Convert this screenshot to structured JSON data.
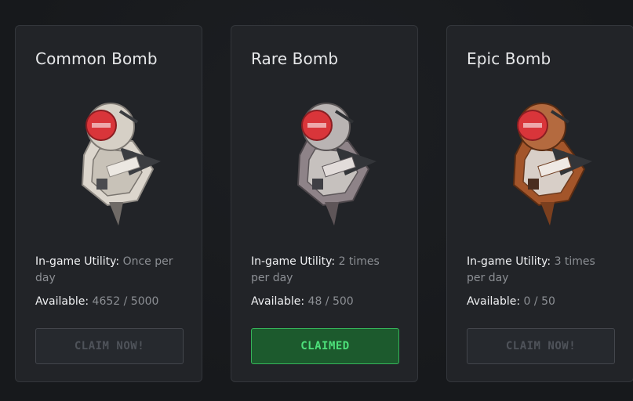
{
  "colors": {
    "page_background": "#17191c",
    "card_background": "#222428",
    "claimed_green": "#4de07a",
    "common_tint": "#d9d4cc",
    "rare_tint": "#9a8f93",
    "epic_tint": "#a55a2e"
  },
  "cards": [
    {
      "title": "Common Bomb",
      "utility_label": "In-game Utility:",
      "utility_value": "Once per day",
      "available_label": "Available:",
      "available_value": "4652 / 5000",
      "button_label": "CLAIM NOW!",
      "button_state": "disabled",
      "icon": "common-bomb-icon"
    },
    {
      "title": "Rare Bomb",
      "utility_label": "In-game Utility:",
      "utility_value": "2 times per day",
      "available_label": "Available:",
      "available_value": "48 / 500",
      "button_label": "CLAIMED",
      "button_state": "claimed",
      "icon": "rare-bomb-icon"
    },
    {
      "title": "Epic Bomb",
      "utility_label": "In-game Utility:",
      "utility_value": "3 times per day",
      "available_label": "Available:",
      "available_value": "0 / 50",
      "button_label": "CLAIM NOW!",
      "button_state": "disabled",
      "icon": "epic-bomb-icon"
    }
  ]
}
